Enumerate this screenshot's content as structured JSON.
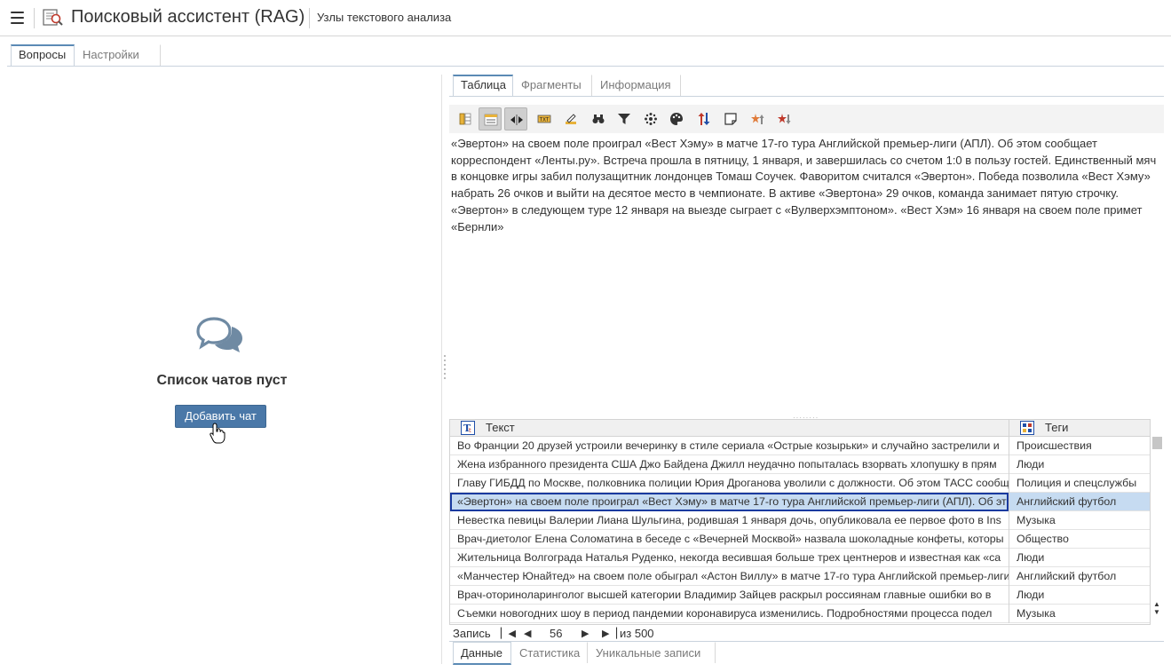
{
  "header": {
    "title": "Поисковый ассистент (RAG)",
    "subtitle": "Узлы текстового анализа"
  },
  "main_tabs": [
    {
      "label": "Вопросы",
      "active": true
    },
    {
      "label": "Настройки",
      "active": false
    }
  ],
  "chat": {
    "empty_text": "Список чатов пуст",
    "add_button": "Добавить чат"
  },
  "view_tabs": [
    {
      "label": "Таблица",
      "active": true
    },
    {
      "label": "Фрагменты",
      "active": false
    },
    {
      "label": "Информация",
      "active": false
    }
  ],
  "toolbar": {
    "icons": [
      "columns-icon",
      "row-view-icon",
      "expand-horizontal-icon",
      "label-icon",
      "edit-icon",
      "binoculars-icon",
      "filter-icon",
      "cluster-icon",
      "palette-icon",
      "sort-icon",
      "note-icon",
      "star-up-icon",
      "star-down-icon"
    ],
    "active_icons": [
      "row-view-icon",
      "expand-horizontal-icon"
    ]
  },
  "document_text": "«Эвертон» на своем поле проиграл «Вест Хэму» в матче 17-го тура Английской премьер-лиги (АПЛ). Об этом сообщает корреспондент «Ленты.ру». Встреча прошла в пятницу, 1 января, и завершилась со счетом 1:0 в пользу гостей. Единственный мяч в концовке игры забил полузащитник лондонцев Томаш Соучек. Фаворитом считался «Эвертон». Победа позволила «Вест Хэму» набрать 26 очков и выйти на десятое место в чемпионате. В активе «Эвертона» 29 очков, команда занимает пятую строчку. «Эвертон» в следующем туре 12 января на выезде сыграет с «Вулверхэмптоном». «Вест Хэм» 16 января на своем поле примет «Бернли»",
  "grid": {
    "columns": [
      "Текст",
      "Теги"
    ],
    "rows": [
      {
        "text": "Во Франции 20 друзей устроили вечеринку в стиле сериала «Острые козырьки» и случайно застрелили и",
        "tag": "Происшествия"
      },
      {
        "text": "Жена избранного президента США Джо Байдена Джилл неудачно попыталась взорвать хлопушку в прям",
        "tag": "Люди"
      },
      {
        "text": "Главу ГИБДД по Москве, полковника полиции Юрия Дроганова уволили с должности. Об этом ТАСС сообщ",
        "tag": "Полиция и спецслужбы"
      },
      {
        "text": "«Эвертон» на своем поле проиграл «Вест Хэму» в матче 17-го тура Английской премьер-лиги (АПЛ). Об эт",
        "tag": "Английский футбол",
        "selected": true
      },
      {
        "text": "Невестка певицы Валерии Лиана Шульгина, родившая 1 января дочь, опубликовала ее первое фото в Ins",
        "tag": "Музыка"
      },
      {
        "text": "Врач-диетолог Елена Соломатина в беседе с «Вечерней Москвой» назвала шоколадные конфеты, которы",
        "tag": "Общество"
      },
      {
        "text": "Жительница Волгограда Наталья Руденко, некогда весившая больше трех центнеров и известная как «са",
        "tag": "Люди"
      },
      {
        "text": "«Манчестер Юнайтед» на своем поле обыграл «Астон Виллу» в матче 17-го тура Английской премьер-лиги",
        "tag": "Английский футбол"
      },
      {
        "text": "Врач-оториноларинголог высшей категории Владимир Зайцев раскрыл россиянам главные ошибки во в",
        "tag": "Люди"
      },
      {
        "text": "Съемки новогодних шоу в период пандемии коронавируса изменились. Подробностями процесса подел",
        "tag": "Музыка"
      }
    ]
  },
  "pager": {
    "label": "Запись",
    "current": "56",
    "of_text": "из 500"
  },
  "bottom_tabs": [
    {
      "label": "Данные",
      "active": true
    },
    {
      "label": "Статистика",
      "active": false
    },
    {
      "label": "Уникальные записи",
      "active": false
    }
  ],
  "colors": {
    "accent": "#4a78a8",
    "selection": "#c6dbf1",
    "selection_border": "#1a3a9f"
  }
}
